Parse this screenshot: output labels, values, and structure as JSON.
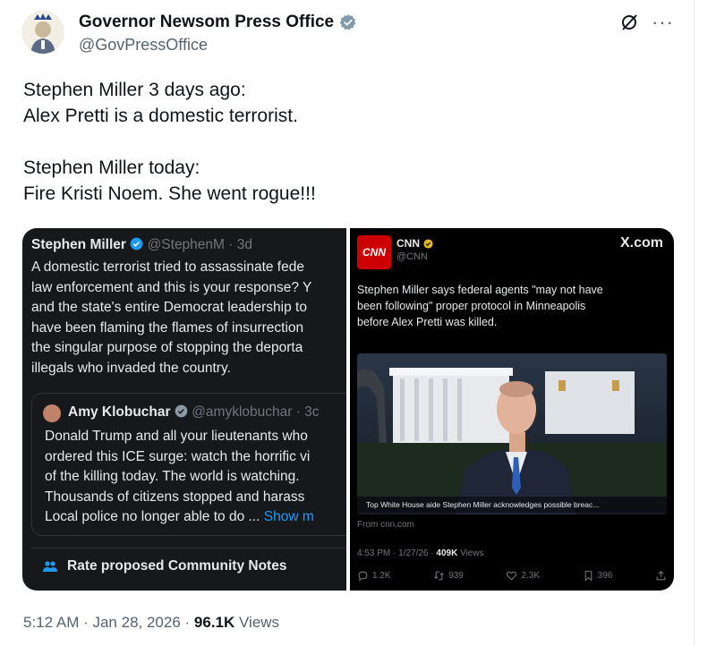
{
  "author": {
    "name": "Governor Newsom Press Office",
    "handle": "@GovPressOffice"
  },
  "header": {
    "grok_icon": "slashed-circle-icon",
    "more_icon": "more-icon",
    "more_glyph": "···"
  },
  "tweet": {
    "lines": [
      "Stephen Miller 3 days ago:",
      "Alex Pretti is a domestic terrorist.",
      "",
      "Stephen Miller today:",
      "Fire Kristi Noem. She went rogue!!!"
    ]
  },
  "left_panel": {
    "name": "Stephen Miller",
    "meta": "@StephenM · 3d",
    "body": [
      "A domestic terrorist tried to assassinate fede",
      "law enforcement and this is your response? Y",
      "and the state's entire Democrat leadership to",
      "have been flaming the flames of insurrection",
      "the singular purpose of stopping the deporta",
      "illegals who invaded the country."
    ],
    "quote": {
      "name": "Amy Klobuchar",
      "meta": "@amyklobuchar · 3c",
      "body": [
        "Donald Trump and all your lieutenants who",
        "ordered this ICE surge: watch the horrific vi",
        "of the killing today. The world is watching.",
        "Thousands  of citizens stopped and harass"
      ],
      "last_line": "Local police no longer able to do ...",
      "show_more": "Show m"
    },
    "notes_label": "Rate proposed Community Notes"
  },
  "right_panel": {
    "logo": "CNN",
    "name": "CNN",
    "handle": "@CNN",
    "brand": "X.com",
    "body": [
      "Stephen Miller says federal agents \"may not have",
      "been following\" proper protocol in Minneapolis",
      "before Alex Pretti was killed."
    ],
    "caption": "Top White House aide Stephen Miller acknowledges possible breac...",
    "from": "From cnn.com",
    "time": "4:53 PM · 1/27/26 · ",
    "views_count": "409K",
    "views_label": " Views",
    "actions": [
      {
        "icon": "reply-icon",
        "value": "1.2K"
      },
      {
        "icon": "repost-icon",
        "value": "939"
      },
      {
        "icon": "like-icon",
        "value": "2.3K"
      },
      {
        "icon": "bookmark-icon",
        "value": "396"
      }
    ]
  },
  "footer": {
    "timestamp": "5:12 AM · Jan 28, 2026 · ",
    "views_count": "96.1K",
    "views_label": " Views"
  },
  "colors": {
    "verified": "#1d9bf0",
    "link": "#1d9bf0",
    "cnn_red": "#cc0000",
    "gold_check": "#e2b719"
  }
}
